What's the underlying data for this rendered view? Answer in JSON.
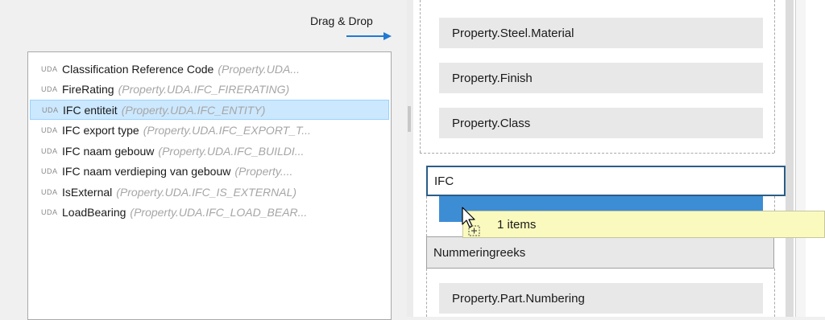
{
  "header": {
    "drag_drop_label": "Drag & Drop"
  },
  "uda_tag": "UDA",
  "list": [
    {
      "name": "Classification Reference Code",
      "prop": "(Property.UDA...",
      "selected": false
    },
    {
      "name": "FireRating",
      "prop": "(Property.UDA.IFC_FIRERATING)",
      "selected": false
    },
    {
      "name": "IFC entiteit",
      "prop": "(Property.UDA.IFC_ENTITY)",
      "selected": true
    },
    {
      "name": "IFC export type",
      "prop": "(Property.UDA.IFC_EXPORT_T...",
      "selected": false
    },
    {
      "name": "IFC naam gebouw",
      "prop": "(Property.UDA.IFC_BUILDI...",
      "selected": false
    },
    {
      "name": "IFC naam verdieping van gebouw",
      "prop": "(Property....",
      "selected": false
    },
    {
      "name": "IsExternal",
      "prop": "(Property.UDA.IFC_IS_EXTERNAL)",
      "selected": false
    },
    {
      "name": "LoadBearing",
      "prop": "(Property.UDA.IFC_LOAD_BEAR...",
      "selected": false
    }
  ],
  "right": {
    "fields_top": [
      "Property.Steel.Material",
      "Property.Finish",
      "Property.Class"
    ],
    "group_ifc": "IFC",
    "group_numbering": "Nummeringreeks",
    "field_bottom": "Property.Part.Numbering"
  },
  "drag_tooltip": "1 items",
  "colors": {
    "selection_bg": "#cce8ff",
    "selection_border": "#99d1ff",
    "drop_indicator": "#3d8dd4",
    "tooltip_bg": "#fafabe",
    "arrow": "#1f7ad1"
  },
  "icons": {
    "cursor": "drag-copy-cursor-icon",
    "arrow": "arrow-right-icon"
  }
}
